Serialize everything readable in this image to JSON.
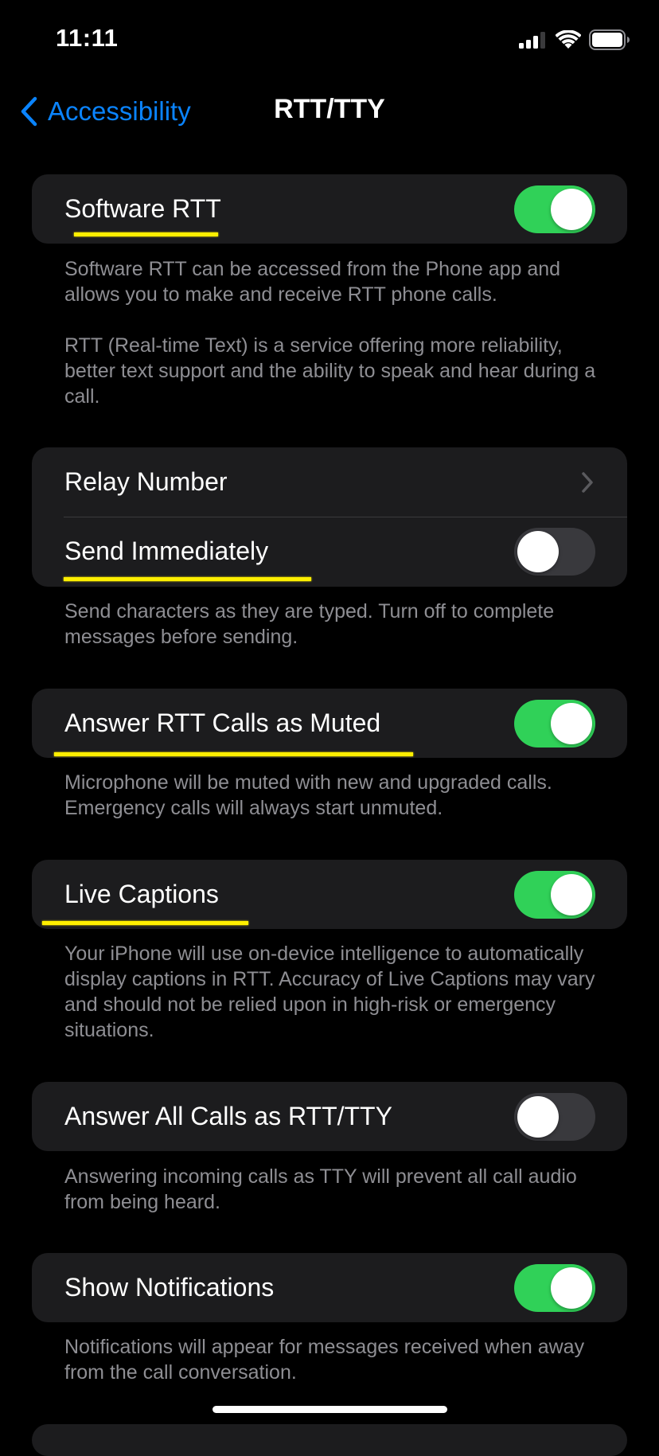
{
  "status_bar": {
    "time": "11:11",
    "icons": [
      "cellular-signal-icon",
      "wifi-icon",
      "battery-icon"
    ]
  },
  "nav": {
    "back_label": "Accessibility",
    "title": "RTT/TTY"
  },
  "colors": {
    "accent": "#0a84ff",
    "toggle_on": "#30d158",
    "toggle_off": "#39393d",
    "card_bg": "#1c1c1e",
    "footer_text": "#8e8e93",
    "annotation_highlight": "#ffef00"
  },
  "sections": [
    {
      "rows": [
        {
          "label": "Software RTT",
          "control": "toggle",
          "on": true,
          "highlighted": true
        }
      ],
      "footer": [
        "Software RTT can be accessed from the Phone app and allows you to make and receive RTT phone calls.",
        "RTT (Real-time Text) is a service offering more reliability, better text support and the ability to speak and hear during a call."
      ]
    },
    {
      "rows": [
        {
          "label": "Relay Number",
          "control": "chevron",
          "highlighted": false
        },
        {
          "label": "Send Immediately",
          "control": "toggle",
          "on": false,
          "highlighted": true
        }
      ],
      "footer": [
        "Send characters as they are typed. Turn off to complete messages before sending."
      ]
    },
    {
      "rows": [
        {
          "label": "Answer RTT Calls as Muted",
          "control": "toggle",
          "on": true,
          "highlighted": true
        }
      ],
      "footer": [
        "Microphone will be muted with new and upgraded calls. Emergency calls will always start unmuted."
      ]
    },
    {
      "rows": [
        {
          "label": "Live Captions",
          "control": "toggle",
          "on": true,
          "highlighted": true
        }
      ],
      "footer": [
        "Your iPhone will use on-device intelligence to automatically display captions in RTT. Accuracy of Live Captions may vary and should not be relied upon in high-risk or emergency situations."
      ]
    },
    {
      "rows": [
        {
          "label": "Answer All Calls as RTT/TTY",
          "control": "toggle",
          "on": false,
          "highlighted": false
        }
      ],
      "footer": [
        "Answering incoming calls as TTY will prevent all call audio from being heard."
      ]
    },
    {
      "rows": [
        {
          "label": "Show Notifications",
          "control": "toggle",
          "on": true,
          "highlighted": false
        }
      ],
      "footer": [
        "Notifications will appear for messages received when away from the call conversation."
      ]
    }
  ]
}
